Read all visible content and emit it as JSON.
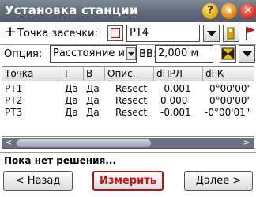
{
  "window": {
    "title": "Установка станции",
    "help_glyph": "?",
    "star_glyph": "★",
    "close_glyph": "✕"
  },
  "point_row": {
    "add_glyph": "+",
    "label": "Точка засечки:",
    "value": "PT4"
  },
  "option_row": {
    "label": "Опция:",
    "option_value": "Расстояние и углы",
    "hv_label": "ВВ:",
    "hv_value": "2,000 м"
  },
  "table": {
    "columns": [
      "Точка",
      "Г",
      "В",
      "Опис.",
      "dПРЛ",
      "dГК"
    ],
    "rows": [
      [
        "PT1",
        "Да",
        "Да",
        "Resect",
        "-0.001",
        "0°00'00\""
      ],
      [
        "PT2",
        "Да",
        "Да",
        "Resect",
        "0.000",
        "0°00'00\""
      ],
      [
        "PT3",
        "Да",
        "Да",
        "Resect",
        "-0.001",
        "-0°00'01\""
      ]
    ]
  },
  "scrollbar": {
    "left_glyph": "<",
    "right_glyph": ">"
  },
  "status": "Пока нет решения...",
  "buttons": {
    "back": "< Назад",
    "measure": "Измерить",
    "next": "Далее >"
  },
  "colors": {
    "titlebar": "#5f6878",
    "measure_accent": "#d01010"
  }
}
